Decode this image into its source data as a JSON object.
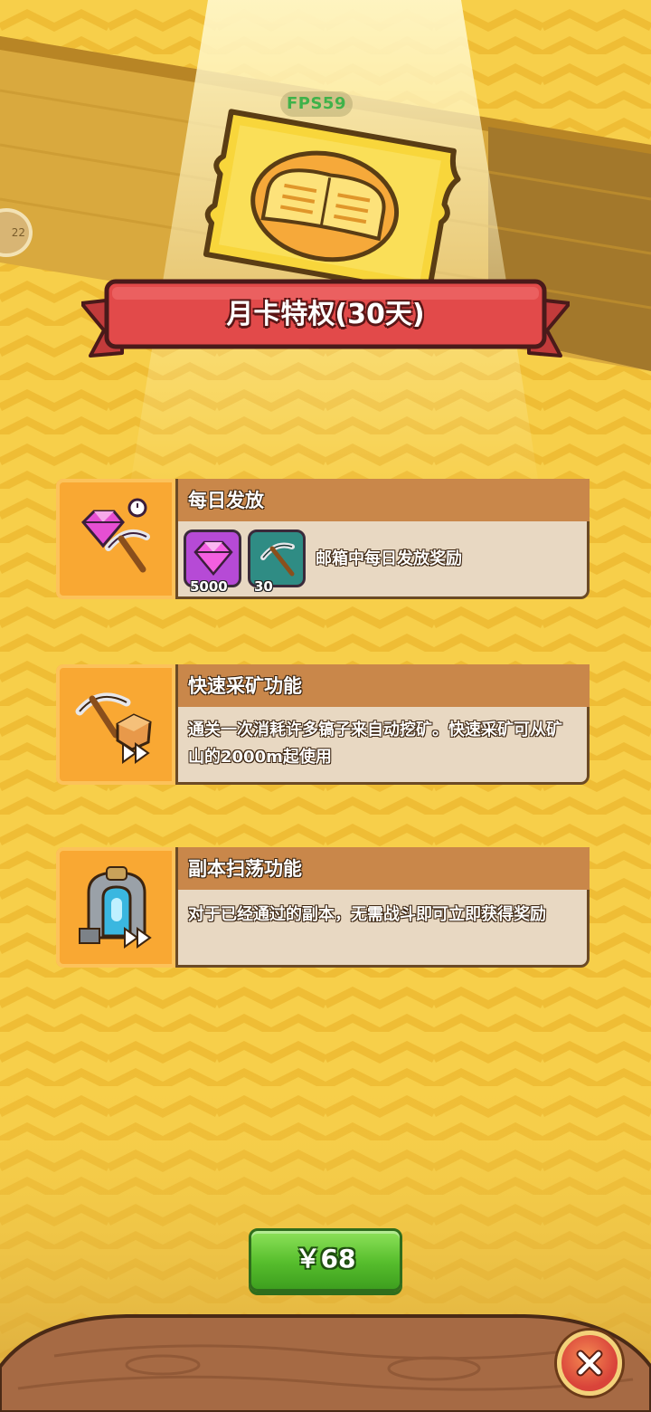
{
  "fps": "FPS59",
  "edge_badge": "22",
  "title": "月卡特权(30天)",
  "features": [
    {
      "title": "每日发放",
      "description": "邮箱中每日发放奖励",
      "rewards": [
        {
          "icon": "gem-icon",
          "qty": "5000",
          "color": "#b64ad6"
        },
        {
          "icon": "pickaxe-icon",
          "qty": "30",
          "color": "#2f8c84"
        }
      ],
      "icon": "gem-pickaxe-icon"
    },
    {
      "title": "快速采矿功能",
      "description": "通关一次消耗许多镐子来自动挖矿。快速采矿可从矿山的2000m起使用",
      "icon": "fast-mining-icon"
    },
    {
      "title": "副本扫荡功能",
      "description": "对于已经通过的副本，无需战斗即可立即获得奖励",
      "icon": "dungeon-sweep-icon"
    }
  ],
  "buy_button": {
    "label": "￥68"
  },
  "colors": {
    "banner": "#e24a4a",
    "card_header": "#c9874a",
    "card_body": "#e8d8c2",
    "icon_bg": "#f9a833",
    "button_green": "#56bd2c"
  }
}
